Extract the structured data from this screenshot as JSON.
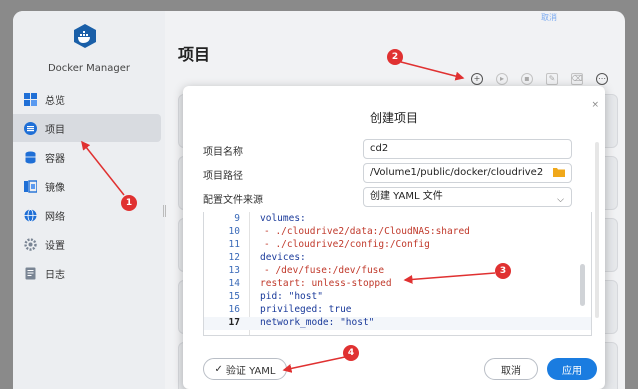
{
  "app": {
    "title": "Docker Manager",
    "top_link": "取消"
  },
  "sidebar": {
    "items": [
      {
        "label": "总览",
        "icon": "overview-icon"
      },
      {
        "label": "项目",
        "icon": "project-icon",
        "active": true
      },
      {
        "label": "容器",
        "icon": "container-icon"
      },
      {
        "label": "镜像",
        "icon": "image-icon"
      },
      {
        "label": "网络",
        "icon": "network-icon"
      },
      {
        "label": "设置",
        "icon": "settings-icon"
      },
      {
        "label": "日志",
        "icon": "log-icon"
      }
    ]
  },
  "main": {
    "title": "项目"
  },
  "toolbar": {
    "buttons": [
      "add-icon",
      "start-icon",
      "stop-icon",
      "edit-icon",
      "delete-icon",
      "more-icon"
    ]
  },
  "modal": {
    "title": "创建项目",
    "close": "×",
    "fields": {
      "name_label": "项目名称",
      "name_value": "cd2",
      "path_label": "项目路径",
      "path_value": "/Volume1/public/docker/cloudrive2",
      "source_label": "配置文件来源",
      "source_value": "创建 YAML 文件"
    },
    "editor": {
      "lines": [
        {
          "num": "9",
          "text": "volumes:"
        },
        {
          "num": "10",
          "text": "- ./cloudrive2/data:/CloudNAS:shared"
        },
        {
          "num": "11",
          "text": "- ./cloudrive2/config:/Config"
        },
        {
          "num": "12",
          "text": "devices:"
        },
        {
          "num": "13",
          "text": "- /dev/fuse:/dev/fuse"
        },
        {
          "num": "14",
          "text": "restart: unless-stopped"
        },
        {
          "num": "15",
          "text": "pid: \"host\""
        },
        {
          "num": "16",
          "text": "privileged: true"
        },
        {
          "num": "17",
          "text": "network_mode: \"host\""
        }
      ]
    },
    "buttons": {
      "verify": "验证 YAML",
      "verify_check": "✓",
      "cancel": "取消",
      "apply": "应用"
    }
  },
  "annotations": {
    "markers": [
      "1",
      "2",
      "3",
      "4"
    ],
    "color": "#e03131"
  },
  "colors": {
    "accent": "#1a7ce0",
    "docker_blue": "#1a5fa8"
  }
}
